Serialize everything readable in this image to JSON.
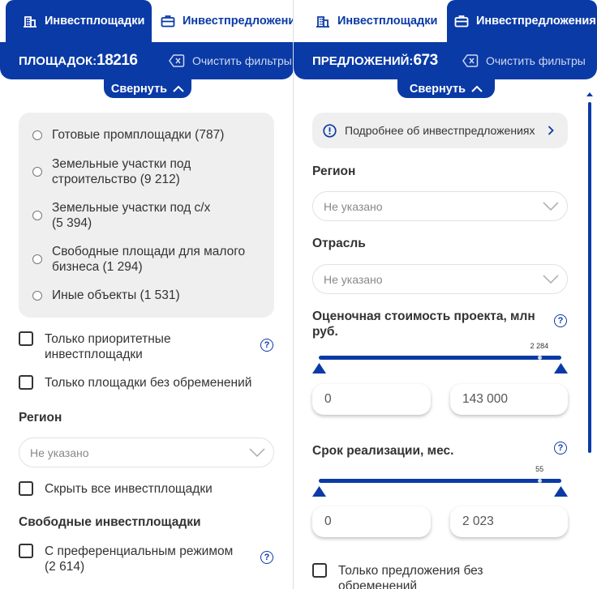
{
  "left": {
    "tabs": [
      {
        "label": "Инвестплощадки",
        "icon": "building-icon",
        "active": true
      },
      {
        "label": "Инвестпредложения",
        "icon": "briefcase-icon",
        "active": false
      }
    ],
    "count_label": "ПЛОЩАДОК:",
    "count_value": "18216",
    "clear_filters": "Очистить фильтры",
    "collapse": "Свернуть",
    "types": [
      {
        "label_line1": "Готовые промплощадки (787)",
        "label_line2": ""
      },
      {
        "label_line1": "Земельные участки под",
        "label_line2": "строительство (9 212)"
      },
      {
        "label_line1": "Земельные участки под с/х",
        "label_line2": "(5 394)"
      },
      {
        "label_line1": "Свободные площади для малого",
        "label_line2": "бизнеса (1 294)"
      },
      {
        "label_line1": "Иные объекты (1 531)",
        "label_line2": ""
      }
    ],
    "priority_line1": "Только приоритетные",
    "priority_line2": "инвестплощадки",
    "no_encumbrance": "Только площадки без обременений",
    "region_title": "Регион",
    "region_placeholder": "Не указано",
    "hide_all": "Скрыть все инвестплощадки",
    "free_title": "Свободные инвестплощадки",
    "preferential_line1": "С преференциальным режимом",
    "preferential_line2": "(2 614)"
  },
  "right": {
    "tabs": [
      {
        "label": "Инвестплощадки",
        "icon": "building-icon",
        "active": false
      },
      {
        "label": "Инвестпредложения",
        "icon": "briefcase-icon",
        "active": true
      }
    ],
    "count_label": "ПРЕДЛОЖЕНИЙ:",
    "count_value": "673",
    "clear_filters": "Очистить фильтры",
    "collapse": "Свернуть",
    "info_link": "Подробнее об инвестпредложениях",
    "region_title": "Регион",
    "region_placeholder": "Не указано",
    "industry_title": "Отрасль",
    "industry_placeholder": "Не указано",
    "cost_title_line1": "Оценочная стоимость проекта, млн",
    "cost_title_line2": "руб.",
    "cost_range": {
      "mark_label": "2 284",
      "min": "0",
      "max": "143 000",
      "mark_fraction": 0.91
    },
    "term_title": "Срок реализации, мес.",
    "term_range": {
      "mark_label": "55",
      "min": "0",
      "max": "2 023",
      "mark_fraction": 0.91
    },
    "no_encumbrance_line1": "Только предложения без",
    "no_encumbrance_line2": "обременений"
  },
  "colors": {
    "primary": "#0a3aa6",
    "panel_bg": "#efefef",
    "text": "#333333"
  }
}
